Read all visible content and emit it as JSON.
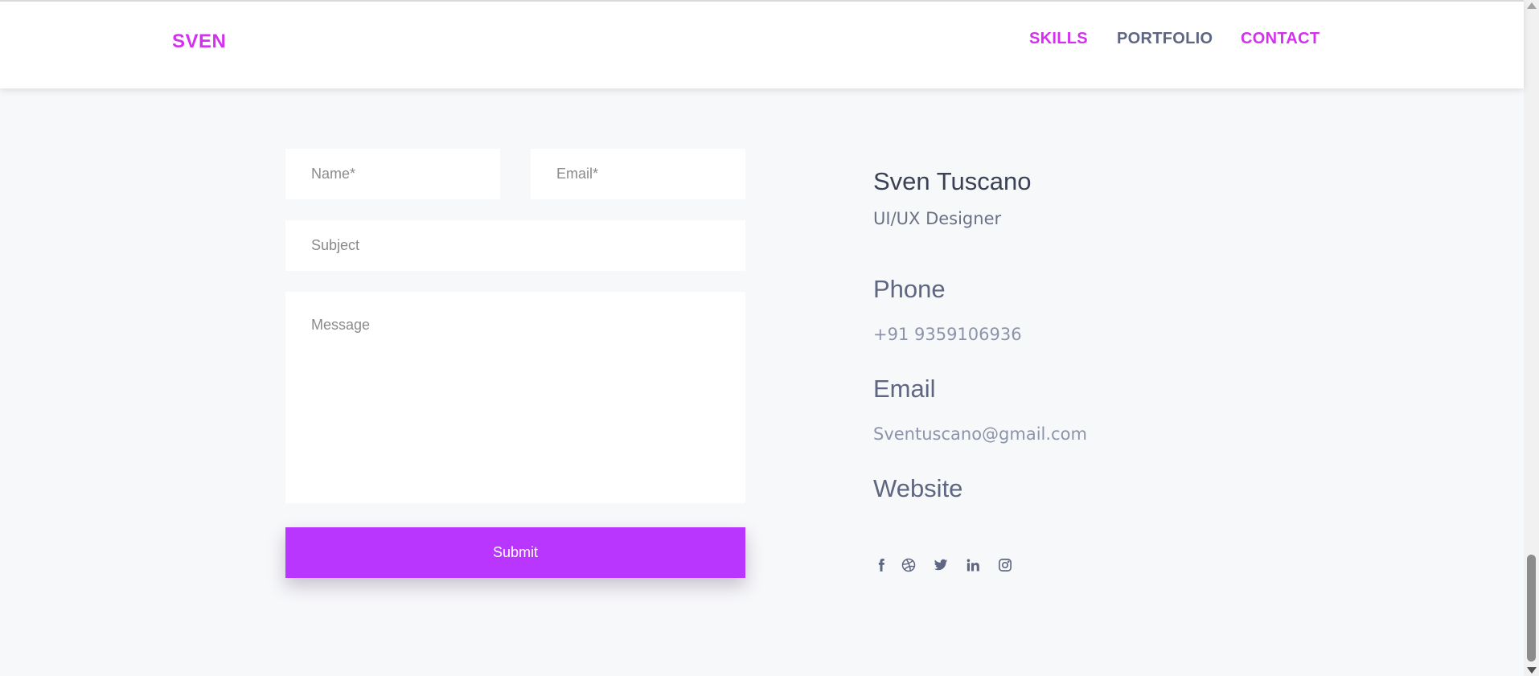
{
  "header": {
    "logo": "SVEN",
    "nav": [
      {
        "label": "SKILLS",
        "color": "#d52ff0"
      },
      {
        "label": "PORTFOLIO",
        "color": "#5e6681"
      },
      {
        "label": "CONTACT",
        "color": "#d52ff0"
      }
    ]
  },
  "form": {
    "name_placeholder": "Name*",
    "email_placeholder": "Email*",
    "subject_placeholder": "Subject",
    "message_placeholder": "Message",
    "submit_label": "Submit"
  },
  "contact": {
    "name": "Sven Tuscano",
    "role": "UI/UX Designer",
    "phone_heading": "Phone",
    "phone": "+91 9359106936",
    "email_heading": "Email",
    "email": "Sventuscano@gmail.com",
    "website_heading": "Website"
  },
  "socials": [
    "facebook-icon",
    "dribbble-icon",
    "twitter-icon",
    "linkedin-icon",
    "instagram-icon"
  ],
  "colors": {
    "accent": "#d52ff0",
    "button": "#b836fd",
    "social_icon": "#5e6681",
    "background": "#f7f8fa"
  }
}
